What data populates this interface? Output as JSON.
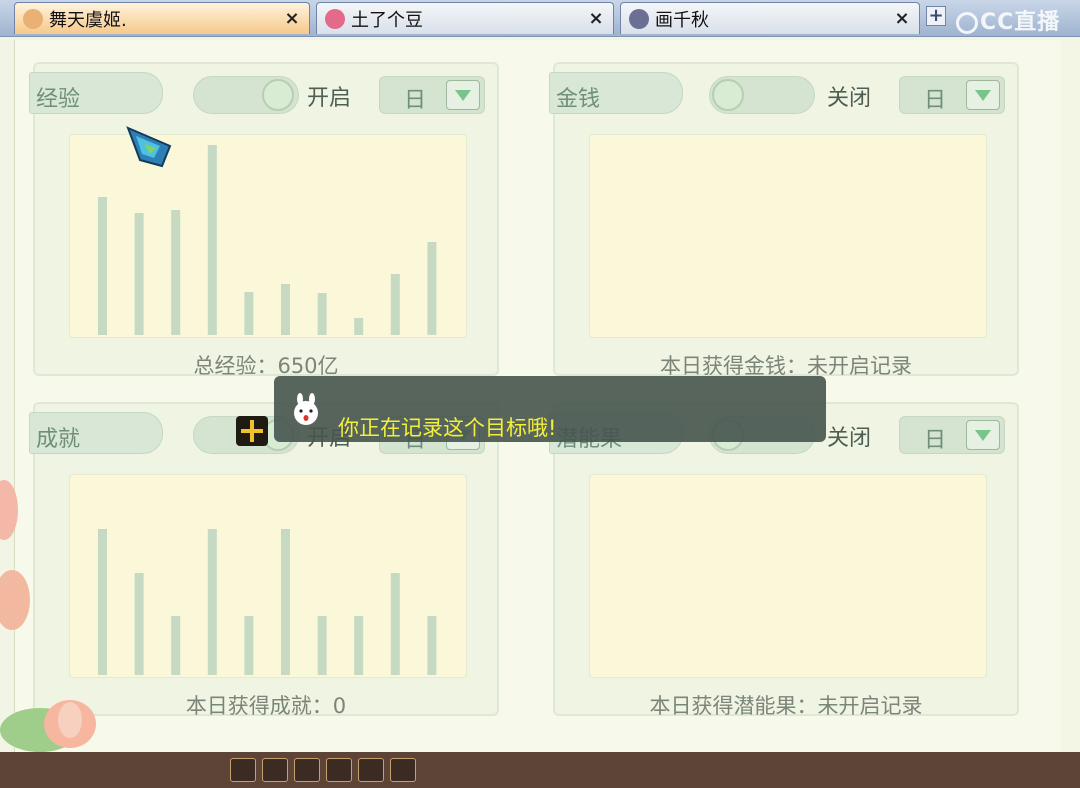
{
  "tabs": [
    {
      "name": "舞天虞姬.",
      "active": true,
      "close": "×"
    },
    {
      "name": "土了个豆",
      "active": false,
      "close": "×"
    },
    {
      "name": "画千秋",
      "active": false,
      "close": "×"
    }
  ],
  "new_tab": "+",
  "watermark": "CC直播",
  "panels": {
    "exp": {
      "title": "经验",
      "toggle_label": "开启",
      "toggle_on": true,
      "period": "日",
      "caption": "总经验：650亿",
      "chart_data": {
        "type": "bar",
        "values": [
          138,
          122,
          125,
          190,
          43,
          51,
          42,
          17,
          61,
          93
        ]
      }
    },
    "money": {
      "title": "金钱",
      "toggle_label": "关闭",
      "toggle_on": false,
      "period": "日",
      "caption": "本日获得金钱：未开启记录"
    },
    "achievement": {
      "title": "成就",
      "toggle_label": "开启",
      "toggle_on": true,
      "period": "日",
      "caption": "本日获得成就：0",
      "chart_data": {
        "type": "bar",
        "values": [
          146,
          102,
          59,
          146,
          59,
          146,
          59,
          59,
          102,
          59
        ]
      }
    },
    "fruit": {
      "title": "潜能果",
      "toggle_label": "关闭",
      "toggle_on": false,
      "period": "日",
      "caption": "本日获得潜能果：未开启记录"
    }
  },
  "tooltip": {
    "text": "你正在记录这个目标哦!"
  },
  "colors": {
    "bar": "#c6d9c3",
    "chart_bg": "#fbf8d9",
    "tooltip_text": "#f3ef3a"
  }
}
